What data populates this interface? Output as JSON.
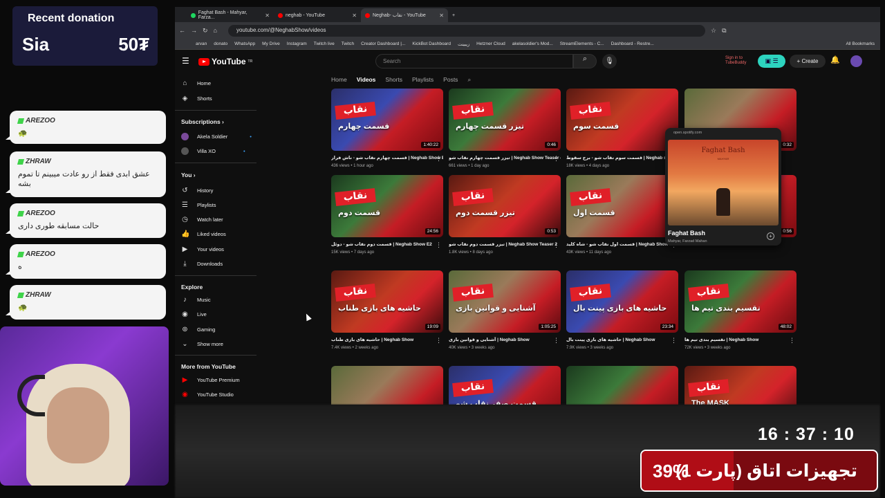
{
  "overlay": {
    "donation": {
      "title": "Recent donation",
      "name": "Sia",
      "amount": "50₮"
    },
    "chat": [
      {
        "user": "AREZOO",
        "message": "🐢"
      },
      {
        "user": "ZHRAW",
        "message": "عشق ابدی فقط از رو عادت میبینم تا تموم بشه"
      },
      {
        "user": "AREZOO",
        "message": "حالت مسابقه طوری داری"
      },
      {
        "user": "AREZOO",
        "message": "ه"
      },
      {
        "user": "ZHRAW",
        "message": "🐢"
      }
    ],
    "clock": "16 : 37 : 10",
    "topic": {
      "percent": "39%",
      "percent_value": 39,
      "text": "تجهیزات اتاق (پارت 1)"
    }
  },
  "browser": {
    "tabs": [
      {
        "label": "Faghat Bash - Mahyar, Farza...",
        "color": "#1ed760"
      },
      {
        "label": "neghab - YouTube",
        "color": "#ff0000"
      },
      {
        "label": "Neghab- نقاب - YouTube",
        "color": "#ff0000"
      }
    ],
    "url": "youtube.com/@NeghabShow/videos",
    "bookmarks": [
      "arvan",
      "donato",
      "WhatsApp",
      "My Drive",
      "Instagram",
      "Twitch live",
      "Twitch",
      "Creator Dashboard |...",
      "KickBot Dashboard",
      "زیبینت",
      "Hetzner Cloud",
      "akelasoldier's Mod...",
      "StreamElements - C...",
      "Dashboard - Restre...",
      "All Bookmarks"
    ]
  },
  "youtube": {
    "logo": "YouTube",
    "logo_sup": "TR",
    "search_placeholder": "Search",
    "signin": "Sign in to TubeBuddy",
    "create": "Create",
    "sidebar": {
      "home": "Home",
      "shorts": "Shorts",
      "subscriptions": "Subscriptions",
      "subs": [
        "Akela Soldier",
        "Villa XO"
      ],
      "you": "You",
      "you_items": [
        "History",
        "Playlists",
        "Watch later",
        "Liked videos",
        "Your videos",
        "Downloads"
      ],
      "explore": "Explore",
      "explore_items": [
        "Music",
        "Live",
        "Gaming",
        "Show more"
      ],
      "more": "More from YouTube",
      "more_items": [
        "YouTube Premium",
        "YouTube Studio"
      ]
    },
    "channel_tabs": [
      "Home",
      "Videos",
      "Shorts",
      "Playlists",
      "Posts"
    ],
    "videos": [
      {
        "thumb": "قسمت چهارم",
        "duration": "1:40:22",
        "title": "قسمت چهارم نقاب شو - ناش فرار | Neghab Show E4",
        "meta": "436 views • 1 hour ago"
      },
      {
        "thumb": "تیزر قسمت چهارم",
        "duration": "0:46",
        "title": "تیزر قسمت چهارم نقاب شو | Neghab Show Teaser 4",
        "meta": "661 views • 1 day ago"
      },
      {
        "thumb": "قسمت سوم",
        "duration": "",
        "title": "قسمت سوم نقاب شو - برج سقوط | Neghab show E3",
        "meta": "18K views • 4 days ago"
      },
      {
        "thumb": "",
        "duration": "0:32",
        "title": "",
        "meta": ""
      },
      {
        "thumb": "قسمت دوم",
        "duration": "24:56",
        "title": "قسمت دوم نقاب شو - دوئل | Neghab Show E2",
        "meta": "15K views • 7 days ago"
      },
      {
        "thumb": "تیزر قسمت دوم",
        "duration": "0:53",
        "title": "تیزر قسمت دوم نقاب شو | Neghab Show Teaser 2",
        "meta": "1.8K views • 8 days ago"
      },
      {
        "thumb": "قسمت اول",
        "duration": "",
        "title": "قسمت اول نقاب شو - شاه کلید | Neghab Show E1",
        "meta": "43K views • 11 days ago"
      },
      {
        "thumb": "",
        "duration": "0:56",
        "title": "",
        "meta": "4.1K views • 11 days ago"
      },
      {
        "thumb": "حاشیه های بازی طناب",
        "duration": "19:09",
        "title": "حاشیه های بازی طناب | Neghab Show",
        "meta": "7.4K views • 2 weeks ago"
      },
      {
        "thumb": "آشنایی و قوانین بازی",
        "duration": "1:05:25",
        "title": "آشنایی و قوانین بازی | Neghab Show",
        "meta": "40K views • 3 weeks ago"
      },
      {
        "thumb": "حاشیه های بازی پینت بال",
        "duration": "23:34",
        "title": "حاشیه های بازی پینت بال | Neghab Show",
        "meta": "7.9K views • 3 weeks ago"
      },
      {
        "thumb": "تقسیم بندی تیم ها",
        "duration": "48:02",
        "title": "تقسیم بندی تیم ها | Neghab Show",
        "meta": "72K views • 3 weeks ago"
      },
      {
        "thumb": "",
        "duration": "",
        "title": "",
        "meta": ""
      },
      {
        "thumb": "قسمت صفر نقاب شو",
        "duration": "",
        "title": "",
        "meta": ""
      },
      {
        "thumb": "",
        "duration": "",
        "title": "",
        "meta": ""
      },
      {
        "thumb": "The MASK",
        "duration": "",
        "title": "",
        "meta": ""
      }
    ],
    "brand": "نقاب"
  },
  "popup": {
    "domain": "open.spotify.com",
    "art_title": "Faghat Bash",
    "art_sub": "MAHYAR",
    "title": "Faghat Bash",
    "artist": "Mahyar, Farzad Mahan"
  }
}
